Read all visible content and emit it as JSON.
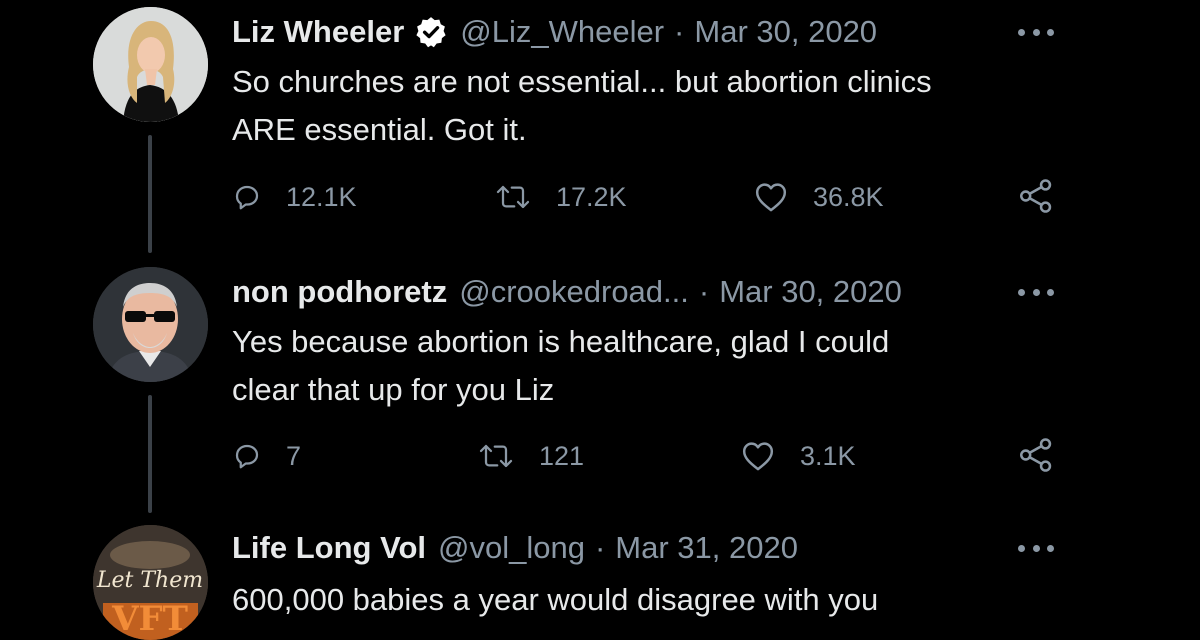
{
  "tweets": [
    {
      "name": "Liz Wheeler",
      "verified": true,
      "handle": "@Liz_Wheeler",
      "separator": "·",
      "date": "Mar 30, 2020",
      "text_lines": [
        "So churches are not essential... but abortion clinics",
        "ARE essential. Got it."
      ],
      "replies": "12.1K",
      "retweets": "17.2K",
      "likes": "36.8K",
      "avatar_icon": "avatar-photo-woman-blonde"
    },
    {
      "name": "non podhoretz",
      "verified": false,
      "handle": "@crookedroad...",
      "separator": "·",
      "date": "Mar 30, 2020",
      "text_lines": [
        "Yes because abortion is healthcare, glad I could",
        "clear that up for you Liz"
      ],
      "replies": "7",
      "retweets": "121",
      "likes": "3.1K",
      "avatar_icon": "avatar-photo-man-sunglasses"
    },
    {
      "name": "Life Long Vol",
      "verified": false,
      "handle": "@vol_long",
      "separator": "·",
      "date": "Mar 31, 2020",
      "text_lines": [
        "600,000 babies a year would disagree with you"
      ],
      "avatar_text": "Let Them",
      "avatar_badge": "VFT",
      "avatar_icon": "avatar-logo-let-them"
    }
  ],
  "colors": {
    "background": "#000000",
    "text": "#e7e9ea",
    "secondary": "#8b98a5",
    "thread_line": "#3b4148",
    "verified_bg": "#ffffff",
    "verified_check": "#000000"
  },
  "icons": {
    "reply": "reply-icon",
    "retweet": "retweet-icon",
    "like": "heart-icon",
    "share": "share-icon",
    "more": "more-options-icon",
    "verified": "verified-badge-icon"
  }
}
